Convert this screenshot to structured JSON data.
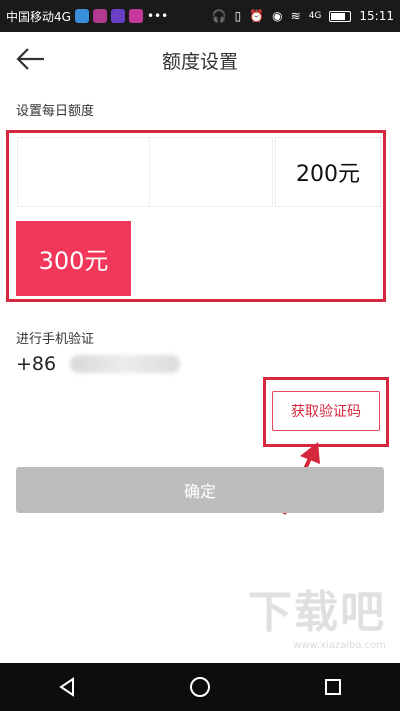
{
  "status_bar": {
    "carrier": "中国移动4G",
    "time": "15:11",
    "network": "4G"
  },
  "header": {
    "title": "额度设置",
    "back_icon": "arrow-left-icon"
  },
  "quota": {
    "label": "设置每日额度",
    "options": [
      {
        "label": "",
        "selected": false
      },
      {
        "label": "",
        "selected": false
      },
      {
        "label": "200元",
        "selected": false
      },
      {
        "label": "300元",
        "selected": true
      }
    ]
  },
  "verify": {
    "label": "进行手机验证",
    "country_code": "+86",
    "get_code_label": "获取验证码"
  },
  "confirm": {
    "label": "确定"
  },
  "watermark": {
    "text": "下载吧",
    "url": "www.xiazaiba.com"
  },
  "colors": {
    "accent": "#f2385a",
    "highlight": "#d6283c",
    "confirm_disabled": "#bdbdbd"
  }
}
